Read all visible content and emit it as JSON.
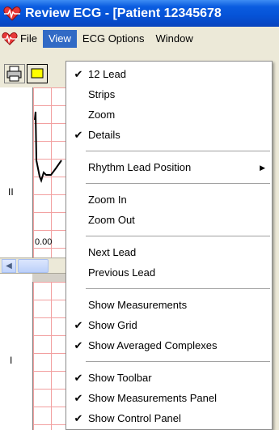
{
  "window": {
    "title": "Review ECG - [Patient 12345678"
  },
  "menubar": {
    "items": [
      {
        "label": "File",
        "active": false
      },
      {
        "label": "View",
        "active": true
      },
      {
        "label": "ECG Options",
        "active": false
      },
      {
        "label": "Window",
        "active": false
      }
    ]
  },
  "ecg": {
    "lead_labels": [
      "II",
      "I"
    ],
    "time_readout": "0.00"
  },
  "view_menu": {
    "items": [
      {
        "label": "12 Lead",
        "checked": true
      },
      {
        "label": "Strips",
        "checked": false
      },
      {
        "label": "Zoom",
        "checked": false
      },
      {
        "label": "Details",
        "checked": true
      },
      {
        "label": "Rhythm Lead Position",
        "checked": false,
        "submenu": true
      },
      {
        "label": "Zoom In",
        "checked": false
      },
      {
        "label": "Zoom Out",
        "checked": false
      },
      {
        "label": "Next Lead",
        "checked": false
      },
      {
        "label": "Previous Lead",
        "checked": false
      },
      {
        "label": "Show Measurements",
        "checked": false
      },
      {
        "label": "Show Grid",
        "checked": true
      },
      {
        "label": "Show Averaged Complexes",
        "checked": true
      },
      {
        "label": "Show Toolbar",
        "checked": true
      },
      {
        "label": "Show Measurements Panel",
        "checked": true
      },
      {
        "label": "Show Control Panel",
        "checked": true
      }
    ],
    "check_glyph": "✔",
    "submenu_glyph": "▶"
  },
  "colors": {
    "titlebar_blue": "#0552d6",
    "menu_highlight": "#316ac5",
    "grid_pink": "#f2a0a0"
  }
}
